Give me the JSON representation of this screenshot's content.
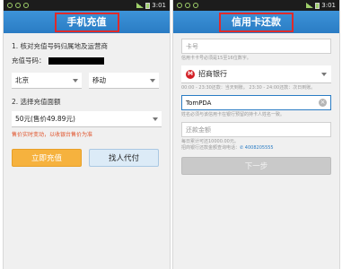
{
  "status_bar": {
    "time": "3:01"
  },
  "left_screen": {
    "title": "手机充值",
    "step1_label": "1. 核对充值号码归属地及运营商",
    "phone_label": "充值号码：",
    "province_value": "北京",
    "carrier_value": "移动",
    "step2_label": "2. 选择充值面额",
    "amount_value": "50元(售价49.89元)",
    "price_note": "售价实时变动，以收银台售价为准",
    "recharge_button": "立即充值",
    "find_payer_button": "找人代付"
  },
  "right_screen": {
    "title": "信用卡还款",
    "card_placeholder": "卡号",
    "card_hint": "信用卡卡号必须是15至16位数字。",
    "bank_value": "招商银行",
    "bank_hours": "00:00 - 23:30还款：当天到账。  23:30 - 24:00还款：次日到账。",
    "name_value": "TomPDA",
    "name_hint": "姓名必须与该信用卡在银行预留的持卡人姓名一致。",
    "amount_placeholder": "还款金额",
    "limit_hint": "每日累计可还10000.00元。",
    "hotline_prefix": "招商银行还款金额查询电话：",
    "hotline_number": "4008205555",
    "next_button": "下一步"
  }
}
